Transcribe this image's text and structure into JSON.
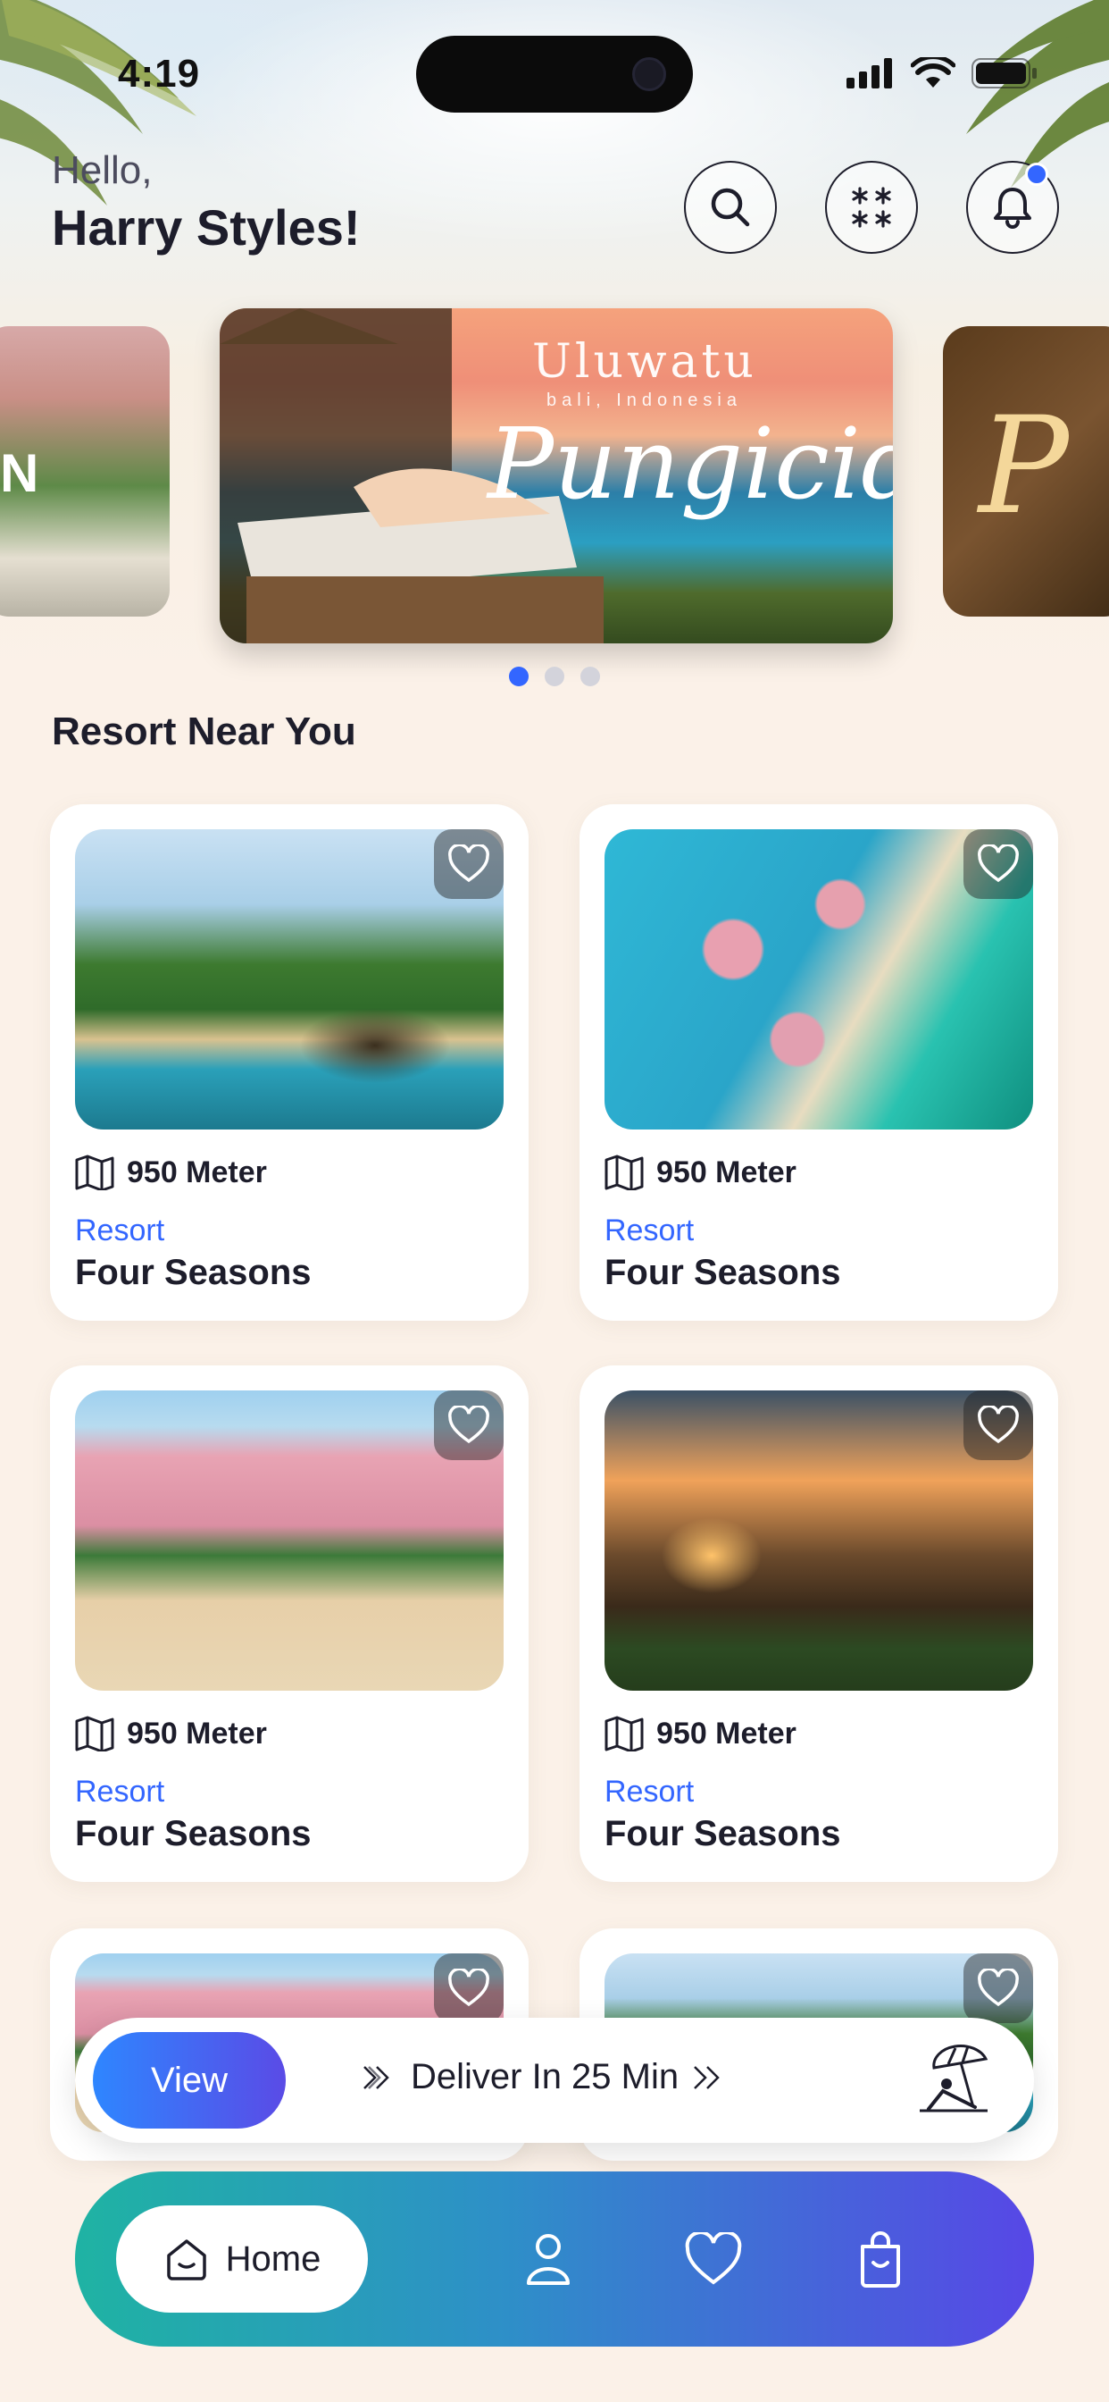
{
  "status_bar": {
    "time": "4:19"
  },
  "header": {
    "greeting": "Hello,",
    "user_name": "Harry Styles!",
    "notification_dot_color": "#3366ff"
  },
  "carousel": {
    "slides": [
      {
        "title": "",
        "subtitle": "",
        "script": "",
        "overlay_letter": "N"
      },
      {
        "title": "Uluwatu",
        "subtitle": "bali, Indonesia",
        "script": "Pungicide"
      },
      {
        "title": "",
        "subtitle": "",
        "script": "P"
      }
    ],
    "active_index": 0,
    "dot_count": 3
  },
  "section": {
    "title": "Resort Near You"
  },
  "resorts": [
    {
      "distance": "950 Meter",
      "category": "Resort",
      "name": "Four Seasons",
      "image": "palm-beach-pool"
    },
    {
      "distance": "950 Meter",
      "category": "Resort",
      "name": "Four Seasons",
      "image": "overwater-villas"
    },
    {
      "distance": "950 Meter",
      "category": "Resort",
      "name": "Four Seasons",
      "image": "pink-hotel-beach"
    },
    {
      "distance": "950 Meter",
      "category": "Resort",
      "name": "Four Seasons",
      "image": "tent-sunset"
    }
  ],
  "deliver_bar": {
    "button_label": "View",
    "text": "Deliver In 25 Min"
  },
  "bottom_nav": {
    "items": [
      {
        "label": "Home",
        "icon": "home-icon",
        "active": true
      },
      {
        "label": "",
        "icon": "user-icon",
        "active": false
      },
      {
        "label": "",
        "icon": "heart-icon",
        "active": false
      },
      {
        "label": "",
        "icon": "bag-icon",
        "active": false
      }
    ]
  },
  "colors": {
    "accent": "#3366ff",
    "text_dark": "#1d1d2b",
    "nav_gradient_start": "#1fb3a3",
    "nav_gradient_end": "#5747e6"
  }
}
